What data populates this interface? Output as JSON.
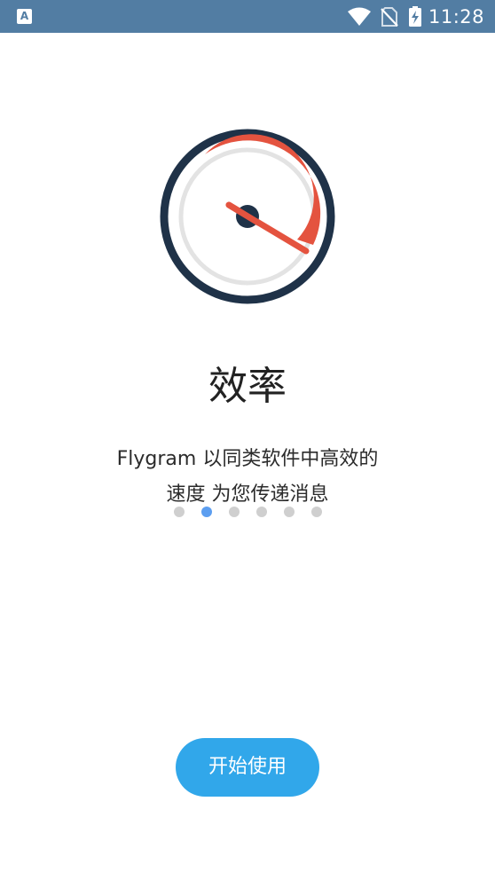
{
  "status_bar": {
    "app_icon_letter": "A",
    "time": "11:28",
    "background": "#527da3",
    "icons": [
      "wifi-icon",
      "no-sim-icon",
      "battery-charging-icon"
    ]
  },
  "onboarding": {
    "illustration": "speedometer-icon",
    "title": "效率",
    "description_line1": "Flygram 以同类软件中高效的",
    "description_line2": "速度 为您传递消息",
    "page_count": 6,
    "active_page": 2,
    "start_button_label": "开始使用"
  },
  "colors": {
    "accent": "#31a7ea",
    "active_dot": "#5c9ef0",
    "inactive_dot": "#cfcfcf",
    "gauge_red": "#e4533f",
    "gauge_navy": "#1f3248"
  }
}
